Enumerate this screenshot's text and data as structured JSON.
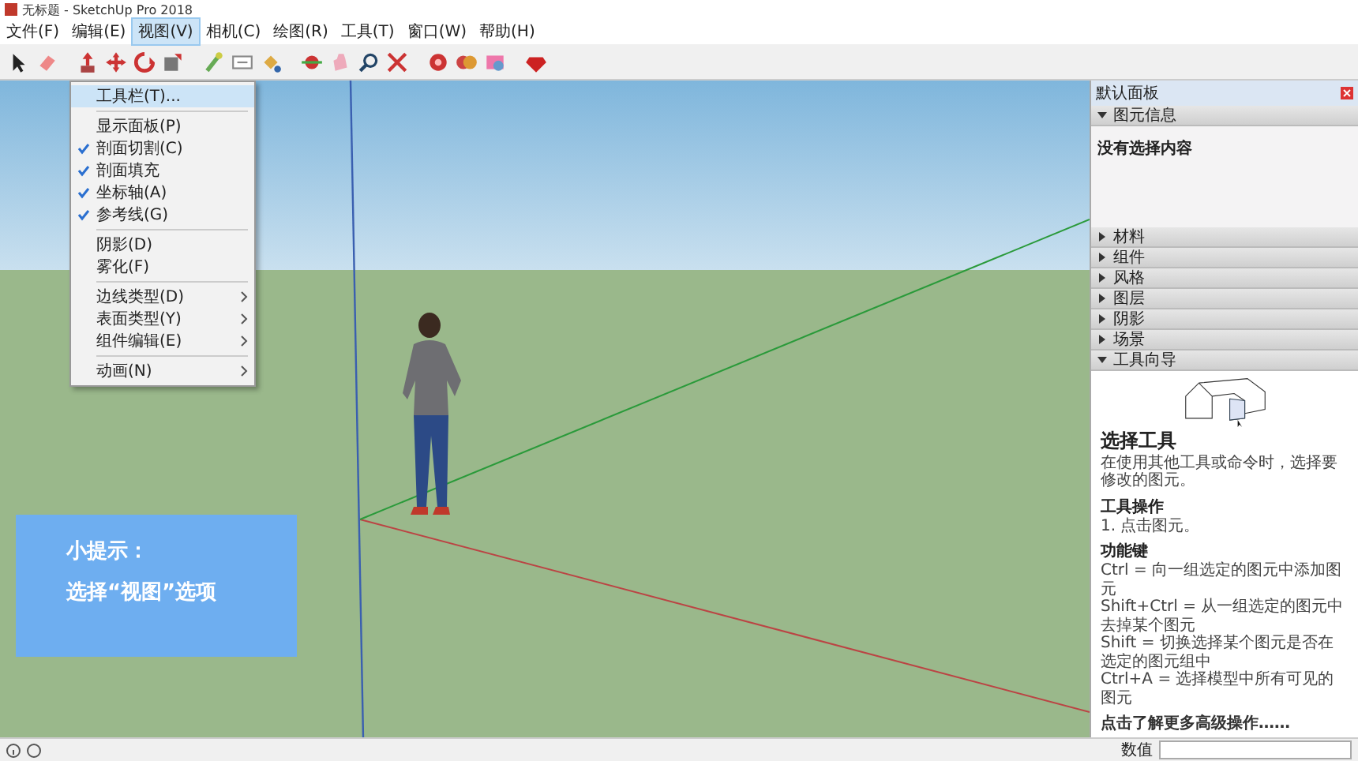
{
  "window": {
    "title": "无标题 - SketchUp Pro 2018"
  },
  "menu_bar": [
    {
      "label": "文件(F)",
      "selected": false
    },
    {
      "label": "编辑(E)",
      "selected": false
    },
    {
      "label": "视图(V)",
      "selected": true
    },
    {
      "label": "相机(C)",
      "selected": false
    },
    {
      "label": "绘图(R)",
      "selected": false
    },
    {
      "label": "工具(T)",
      "selected": false
    },
    {
      "label": "窗口(W)",
      "selected": false
    },
    {
      "label": "帮助(H)",
      "selected": false
    }
  ],
  "view_menu": {
    "groups": [
      [
        {
          "label": "工具栏(T)...",
          "selected": true,
          "checked": false,
          "submenu": false
        }
      ],
      [
        {
          "label": "显示面板(P)",
          "selected": false,
          "checked": false,
          "submenu": false
        },
        {
          "label": "剖面切割(C)",
          "selected": false,
          "checked": true,
          "submenu": false
        },
        {
          "label": "剖面填充",
          "selected": false,
          "checked": true,
          "submenu": false
        },
        {
          "label": "坐标轴(A)",
          "selected": false,
          "checked": true,
          "submenu": false
        },
        {
          "label": "参考线(G)",
          "selected": false,
          "checked": true,
          "submenu": false
        }
      ],
      [
        {
          "label": "阴影(D)",
          "selected": false,
          "checked": false,
          "submenu": false
        },
        {
          "label": "雾化(F)",
          "selected": false,
          "checked": false,
          "submenu": false
        }
      ],
      [
        {
          "label": "边线类型(D)",
          "selected": false,
          "checked": false,
          "submenu": true
        },
        {
          "label": "表面类型(Y)",
          "selected": false,
          "checked": false,
          "submenu": true
        },
        {
          "label": "组件编辑(E)",
          "selected": false,
          "checked": false,
          "submenu": true
        }
      ],
      [
        {
          "label": "动画(N)",
          "selected": false,
          "checked": false,
          "submenu": true
        }
      ]
    ]
  },
  "tip_box": {
    "title": "小提示：",
    "text": "选择“视图”选项"
  },
  "tray": {
    "title": "默认面板",
    "entity_info": {
      "title": "图元信息",
      "expanded": true,
      "text": "没有选择内容"
    },
    "sections": [
      {
        "title": "材料",
        "expanded": false
      },
      {
        "title": "组件",
        "expanded": false
      },
      {
        "title": "风格",
        "expanded": false
      },
      {
        "title": "图层",
        "expanded": false
      },
      {
        "title": "阴影",
        "expanded": false
      },
      {
        "title": "场景",
        "expanded": false
      },
      {
        "title": "工具向导",
        "expanded": true
      }
    ],
    "instructor": {
      "tool_name": "选择工具",
      "description": "在使用其他工具或命令时，选择要修改的图元。",
      "operation_heading": "工具操作",
      "operation": "1. 点击图元。",
      "keys_heading": "功能键",
      "keys": [
        "Ctrl = 向一组选定的图元中添加图元",
        "Shift+Ctrl = 从一组选定的图元中去掉某个图元",
        "Shift = 切换选择某个图元是否在选定的图元组中",
        "Ctrl+A = 选择模型中所有可见的图元"
      ],
      "more_link": "点击了解更多高级操作……"
    }
  },
  "status_bar": {
    "measure_label": "数值"
  }
}
